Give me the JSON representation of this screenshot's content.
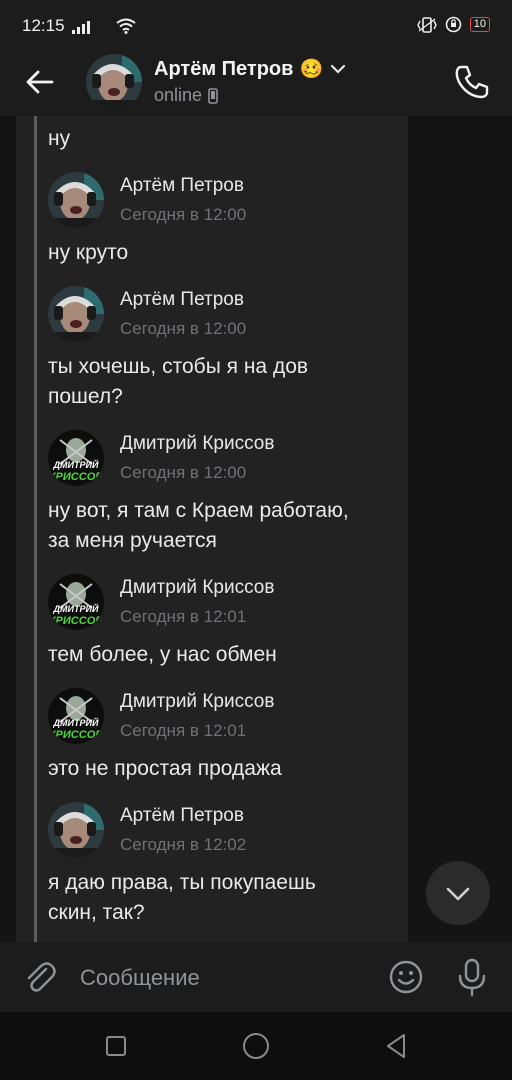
{
  "status_bar": {
    "time": "12:15",
    "battery": "10"
  },
  "header": {
    "back_icon": "arrow-left-icon",
    "name": "Артём Петров",
    "emoji": "🥴",
    "status": "online",
    "call_icon": "phone-icon"
  },
  "messages": [
    {
      "kind": "text",
      "text": "ну"
    },
    {
      "kind": "author",
      "name": "Артём Петров",
      "time": "Сегодня в 12:00",
      "avatar": "artem"
    },
    {
      "kind": "text",
      "text": "ну круто"
    },
    {
      "kind": "author",
      "name": "Артём Петров",
      "time": "Сегодня в 12:00",
      "avatar": "artem"
    },
    {
      "kind": "text",
      "text": "ты хочешь, стобы я на дов\nпошел?"
    },
    {
      "kind": "author",
      "name": "Дмитрий Криссов",
      "time": "Сегодня в 12:00",
      "avatar": "dmitry"
    },
    {
      "kind": "text",
      "text": "ну вот, я там с Краем работаю,\nза меня ручается"
    },
    {
      "kind": "author",
      "name": "Дмитрий Криссов",
      "time": "Сегодня в 12:01",
      "avatar": "dmitry"
    },
    {
      "kind": "text",
      "text": "тем более, у нас обмен"
    },
    {
      "kind": "author",
      "name": "Дмитрий Криссов",
      "time": "Сегодня в 12:01",
      "avatar": "dmitry"
    },
    {
      "kind": "text",
      "text": "это не простая продажа"
    },
    {
      "kind": "author",
      "name": "Артём Петров",
      "time": "Сегодня в 12:02",
      "avatar": "artem"
    },
    {
      "kind": "text",
      "text": "я даю права, ты покупаешь\nскин, так?"
    },
    {
      "kind": "author",
      "name": "Дмитрий Криссов",
      "time": "",
      "avatar": "dmitry"
    }
  ],
  "avatar_logo_text": [
    "ДМИТРИЙ",
    "КРИССОВ"
  ],
  "composer": {
    "placeholder": "Сообщение"
  },
  "colors": {
    "background": "#141414",
    "bars": "#1c1c1c",
    "quote": "#222222",
    "logo_green": "#4fd63a"
  }
}
